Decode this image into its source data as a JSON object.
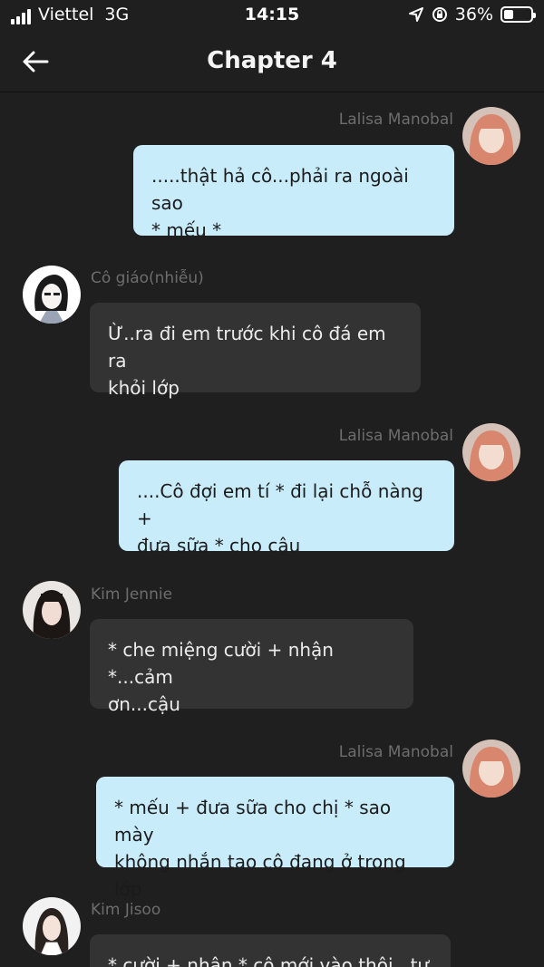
{
  "status": {
    "carrier": "Viettel",
    "network": "3G",
    "time": "14:15",
    "battery": "36%",
    "battery_level": 0.36
  },
  "nav": {
    "title": "Chapter 4"
  },
  "messages": [
    {
      "sender": "Lalisa Manobal",
      "text": ".....thật hả cô...phải ra ngoài sao\n* mếu *"
    },
    {
      "sender": "Cô giáo(nhiễu)",
      "text": "Ừ..ra đi em trước khi cô đá em ra\nkhỏi lớp"
    },
    {
      "sender": "Lalisa Manobal",
      "text": "....Cô đợi em tí * đi lại chỗ nàng +\nđưa sữa * cho cậu"
    },
    {
      "sender": "Kim Jennie",
      "text": "* che miệng cười + nhận *...cảm\nơn...cậu"
    },
    {
      "sender": "Lalisa Manobal",
      "text": "* mếu + đưa sữa cho chị * sao mày\nkhông nhắn tao cô đang ở trong lớp"
    },
    {
      "sender": "Kim Jisoo",
      "text": "* cười + nhận * cô mới vào thôi...tự"
    }
  ],
  "colors": {
    "background": "#1f1f1f",
    "outgoing_bubble": "#c9ecfb",
    "incoming_bubble": "#333333",
    "sender_name": "#6d6d6d"
  },
  "icons": {
    "back": "arrow-left-icon",
    "location": "location-arrow-icon",
    "rotation_lock": "rotation-lock-icon"
  }
}
